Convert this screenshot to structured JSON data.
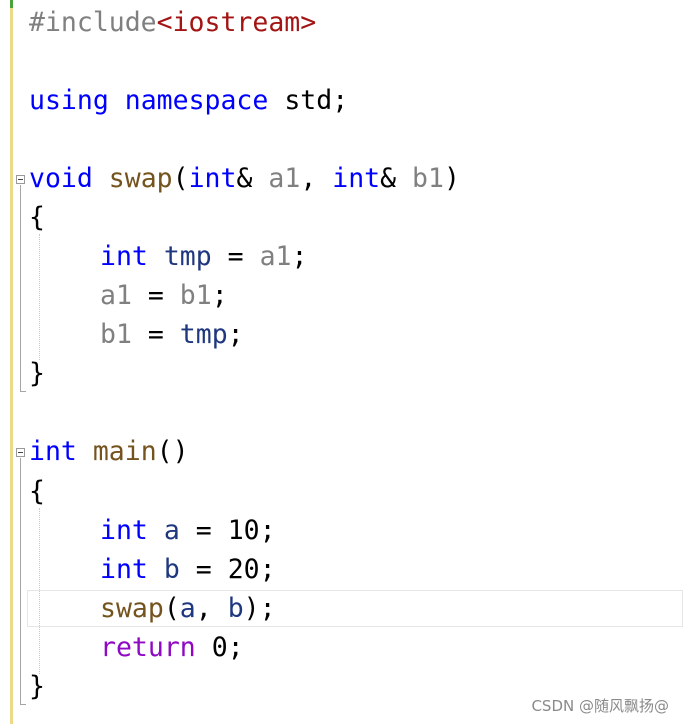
{
  "code": {
    "l1": {
      "directive": "#include",
      "header": "<iostream>"
    },
    "l2": {
      "kw_using": "using",
      "kw_namespace": "namespace",
      "ns": "std",
      "semi": ";"
    },
    "l3": {
      "kw_void": "void",
      "fn_name": "swap",
      "open": "(",
      "type1": "int",
      "ref1": "& ",
      "param1": "a1",
      "comma": ", ",
      "type2": "int",
      "ref2": "& ",
      "param2": "b1",
      "close": ")"
    },
    "l4": {
      "brace": "{"
    },
    "l5": {
      "type": "int",
      "var": "tmp",
      "op": " = ",
      "param": "a1",
      "semi": ";"
    },
    "l6": {
      "param_a": "a1",
      "op": " = ",
      "param_b": "b1",
      "semi": ";"
    },
    "l7": {
      "param": "b1",
      "op": " = ",
      "var": "tmp",
      "semi": ";"
    },
    "l8": {
      "brace": "}"
    },
    "l9": {
      "type": "int",
      "fn_name": "main",
      "parens": "()"
    },
    "l10": {
      "brace": "{"
    },
    "l11": {
      "type": "int",
      "var": "a",
      "op": " = ",
      "num": "10",
      "semi": ";"
    },
    "l12": {
      "type": "int",
      "var": "b",
      "op": " = ",
      "num": "20",
      "semi": ";"
    },
    "l13": {
      "fn_name": "swap",
      "open": "(",
      "arg1": "a",
      "comma": ", ",
      "arg2": "b",
      "close": ");"
    },
    "l14": {
      "kw_return": "return",
      "num": " 0",
      "semi": ";"
    },
    "l15": {
      "brace": "}"
    }
  },
  "watermark": "CSDN @随风飘扬@",
  "colors": {
    "keyword": "#0000ff",
    "control_keyword": "#8f08c4",
    "function": "#74531f",
    "parameter": "#808080",
    "local_variable": "#1f377f",
    "string": "#a31515",
    "change_bar": "#ecd98a"
  }
}
